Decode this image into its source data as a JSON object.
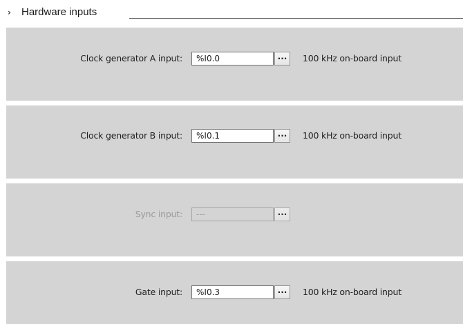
{
  "section": {
    "title": "Hardware inputs",
    "icon": "chevron-right-icon"
  },
  "rows": [
    {
      "label": "Clock generator A input:",
      "value": "%I0.0",
      "browse_label": "...",
      "hint": "100 kHz on-board input",
      "enabled": true
    },
    {
      "label": "Clock generator B input:",
      "value": "%I0.1",
      "browse_label": "...",
      "hint": "100 kHz on-board input",
      "enabled": true
    },
    {
      "label": "Sync input:",
      "value": "---",
      "browse_label": "...",
      "hint": "",
      "enabled": false
    },
    {
      "label": "Gate input:",
      "value": "%I0.3",
      "browse_label": "...",
      "hint": "100 kHz on-board input",
      "enabled": true
    }
  ]
}
